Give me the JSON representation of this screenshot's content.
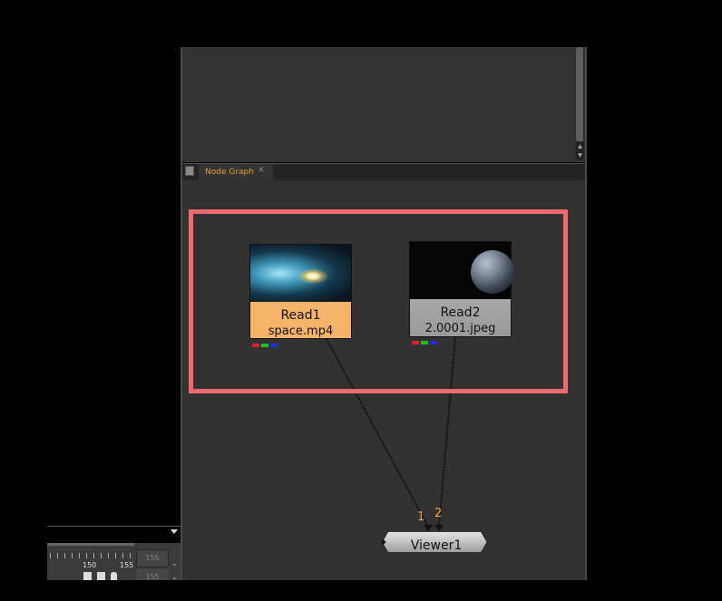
{
  "node_graph_tab": {
    "label": "Node Graph",
    "close": "✕"
  },
  "nodes": {
    "read1": {
      "title": "Read1",
      "file": "space.mp4"
    },
    "read2": {
      "title": "Read2",
      "file": "2.0001.jpeg"
    },
    "viewer1": {
      "title": "Viewer1",
      "input1": "1",
      "input2": "2"
    }
  },
  "timeline": {
    "tick_a": "150",
    "tick_b": "155",
    "field_value": "155",
    "field_value2": "155"
  },
  "colors": {
    "highlight": "#f26a6d",
    "read1_tile": "#f6b46b",
    "tab_accent": "#e0a040"
  }
}
